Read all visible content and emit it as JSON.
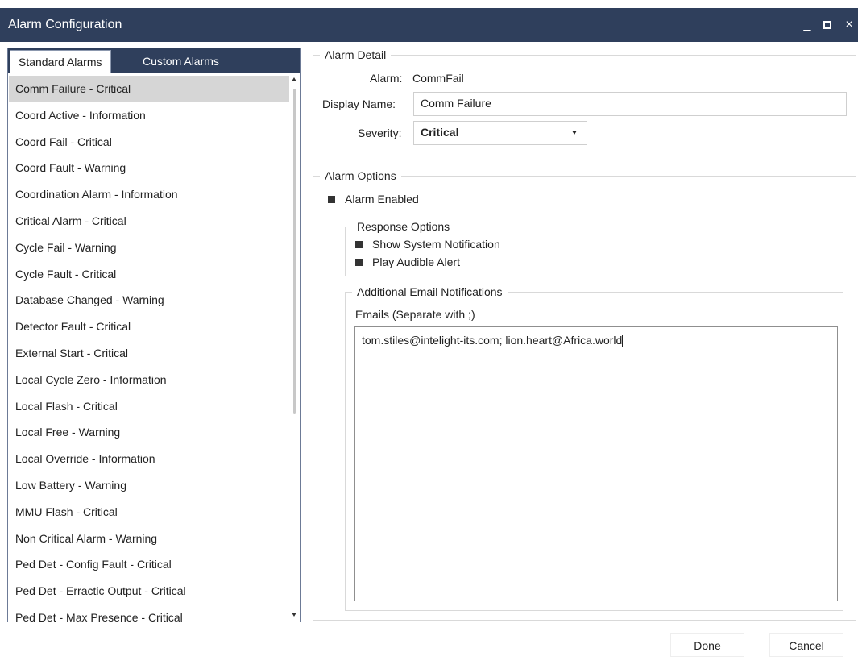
{
  "window": {
    "title": "Alarm Configuration",
    "minimize_glyph": "_",
    "close_glyph": "×"
  },
  "tabs": [
    {
      "label": "Standard Alarms",
      "active": true
    },
    {
      "label": "Custom Alarms",
      "active": false
    }
  ],
  "alarm_list": {
    "selected_index": 0,
    "items": [
      "Comm Failure - Critical",
      "Coord Active - Information",
      "Coord Fail - Critical",
      "Coord Fault - Warning",
      "Coordination Alarm - Information",
      "Critical Alarm - Critical",
      "Cycle Fail - Warning",
      "Cycle Fault - Critical",
      "Database Changed - Warning",
      "Detector Fault - Critical",
      "External Start - Critical",
      "Local Cycle Zero - Information",
      "Local Flash - Critical",
      "Local Free - Warning",
      "Local Override - Information",
      "Low Battery - Warning",
      "MMU Flash - Critical",
      "Non Critical Alarm - Warning",
      "Ped Det - Config Fault - Critical",
      "Ped Det - Erractic Output - Critical",
      "Ped Det - Max Presence - Critical"
    ]
  },
  "alarm_detail": {
    "legend": "Alarm Detail",
    "alarm_label": "Alarm:",
    "alarm_value": "CommFail",
    "display_name_label": "Display Name:",
    "display_name_value": "Comm Failure",
    "severity_label": "Severity:",
    "severity_value": "Critical"
  },
  "alarm_options": {
    "legend": "Alarm Options",
    "alarm_enabled_label": "Alarm Enabled",
    "alarm_enabled": true,
    "response_options": {
      "legend": "Response Options",
      "show_notification_label": "Show System Notification",
      "show_notification": true,
      "play_alert_label": "Play Audible Alert",
      "play_alert": true
    },
    "email": {
      "legend": "Additional Email Notifications",
      "emails_label": "Emails (Separate with ;)",
      "emails_value": "tom.stiles@intelight-its.com; lion.heart@Africa.world"
    }
  },
  "buttons": {
    "done": "Done",
    "cancel": "Cancel"
  },
  "colors": {
    "titlebar": "#2f3f5c",
    "selected_row": "#d6d6d6",
    "checkbox_fill": "#333333"
  }
}
